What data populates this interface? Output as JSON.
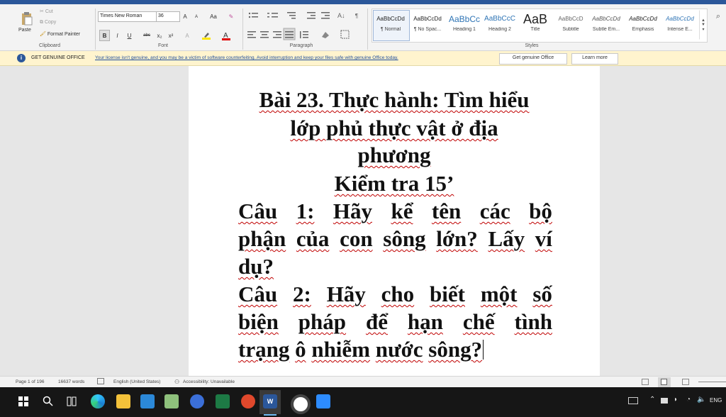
{
  "ribbon": {
    "clipboard": {
      "paste": "Paste",
      "cut": "Cut",
      "copy": "Copy",
      "format_painter": "Format Painter",
      "group": "Clipboard"
    },
    "font": {
      "font_name": "Times New Roman",
      "font_size": "36",
      "grow": "A",
      "shrink": "A",
      "case": "Aa",
      "bold": "B",
      "italic": "I",
      "underline": "U",
      "strike": "abc",
      "subscript": "x₂",
      "superscript": "x²",
      "group": "Font"
    },
    "paragraph": {
      "group": "Paragraph",
      "pilcrow": "¶"
    },
    "styles": {
      "group": "Styles",
      "items": [
        {
          "preview": "AaBbCcDd",
          "name": "¶ Normal"
        },
        {
          "preview": "AaBbCcDd",
          "name": "¶ No Spac..."
        },
        {
          "preview": "AaBbCc",
          "name": "Heading 1"
        },
        {
          "preview": "AaBbCcC",
          "name": "Heading 2"
        },
        {
          "preview": "AaB",
          "name": "Title"
        },
        {
          "preview": "AaBbCcD",
          "name": "Subtitle"
        },
        {
          "preview": "AaBbCcDd",
          "name": "Subtle Em..."
        },
        {
          "preview": "AaBbCcDd",
          "name": "Emphasis"
        },
        {
          "preview": "AaBbCcDd",
          "name": "Intense E..."
        }
      ]
    }
  },
  "message_bar": {
    "title": "GET GENUINE OFFICE",
    "text": "Your license isn't genuine, and you may be a victim of software counterfeiting. Avoid interruption and keep your files safe with genuine Office today.",
    "button_primary": "Get genuine Office",
    "button_secondary": "Learn more"
  },
  "document": {
    "title_lines": [
      "Bài 23. Thực hành: Tìm hiểu",
      "lớp phủ thực vật ở địa",
      "phương",
      "Kiểm tra 15’"
    ],
    "question1_lines": [
      [
        "Câu",
        "1:",
        "Hãy",
        "kể",
        "tên",
        "các",
        "bộ"
      ],
      [
        "phận",
        "của",
        "con",
        "sông",
        "lớn?",
        "Lấy",
        "ví"
      ],
      [
        "dụ?"
      ]
    ],
    "question2_lines": [
      [
        "Câu",
        "2:",
        "Hãy",
        "cho",
        "biết",
        "một",
        "số"
      ],
      [
        "biện",
        "pháp",
        "để",
        "hạn",
        "chế",
        "tình"
      ],
      [
        "trạng",
        "ô",
        "nhiễm",
        "nước",
        "sông?"
      ]
    ]
  },
  "status_bar": {
    "page": "Page 1 of 196",
    "words": "16637 words",
    "language": "English (United States)",
    "accessibility": "Accessibility: Unavailable"
  },
  "taskbar": {
    "language": "ENG"
  },
  "colors": {
    "word_blue": "#2b579a",
    "message_bar_bg": "#fff4ce",
    "spell_underline": "#c00000",
    "taskbar_bg": "#161616"
  }
}
